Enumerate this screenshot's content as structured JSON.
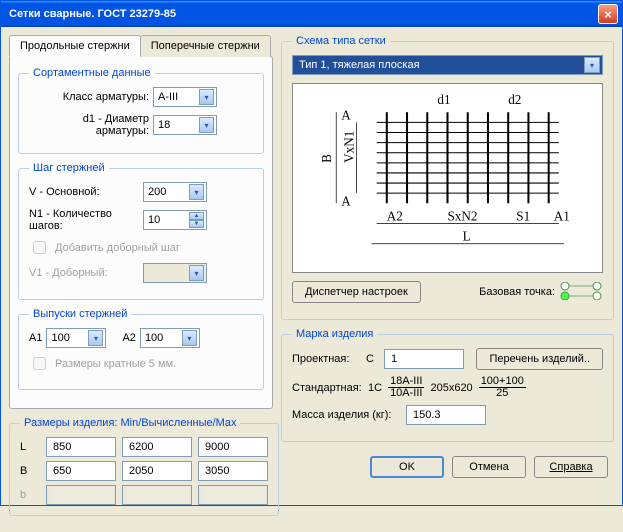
{
  "window": {
    "title": "Сетки сварные. ГОСТ 23279-85"
  },
  "tabs": {
    "longitudinal": "Продольные стержни",
    "transverse": "Поперечные стержни"
  },
  "assort": {
    "legend": "Сортаментные данные",
    "class_label": "Класс арматуры:",
    "class_value": "A-III",
    "d1_label": "d1 - Диаметр арматуры:",
    "d1_value": "18"
  },
  "step": {
    "legend": "Шаг стержней",
    "v_label": "V - Основной:",
    "v_value": "200",
    "n1_label": "N1 - Количество шагов:",
    "n1_value": "10",
    "add_extra": "Добавить доборный шаг",
    "v1_label": "V1 - Доборный:",
    "v1_value": ""
  },
  "release": {
    "legend": "Выпуски стержней",
    "a1_label": "A1",
    "a1_value": "100",
    "a2_label": "A2",
    "a2_value": "100",
    "mult5": "Размеры кратные 5 мм."
  },
  "sizes": {
    "legend": "Размеры изделия: Min/Вычисленные/Max",
    "L": "L",
    "L_min": "850",
    "L_calc": "6200",
    "L_max": "9000",
    "B": "B",
    "B_min": "650",
    "B_calc": "2050",
    "B_max": "3050",
    "b": "b",
    "b_min": "",
    "b_calc": "",
    "b_max": ""
  },
  "schema": {
    "legend": "Схема типа сетки",
    "type": "Тип 1, тяжелая плоская",
    "dispatch": "Диспетчер настроек",
    "basepoint": "Базовая точка:",
    "diag": {
      "A": "A",
      "B": "B",
      "d1": "d1",
      "d2": "d2",
      "VxN1": "VxN1",
      "A2": "A2",
      "SxN2": "SxN2",
      "S1": "S1",
      "A1": "A1",
      "L": "L"
    }
  },
  "mark": {
    "legend": "Марка изделия",
    "proj_label": "Проектная:",
    "prefix": "C",
    "proj_value": "1",
    "list_btn": "Перечень изделий..",
    "std_label": "Стандартная:",
    "std_prefix": "1C",
    "std_num": "18A-III",
    "std_den": "10A-III",
    "std_mid": "205x620",
    "std_num2": "100+100",
    "std_den2": "25",
    "mass_label": "Масса изделия (кг):",
    "mass_value": "150.3"
  },
  "buttons": {
    "ok": "OK",
    "cancel": "Отмена",
    "help": "Справка"
  }
}
